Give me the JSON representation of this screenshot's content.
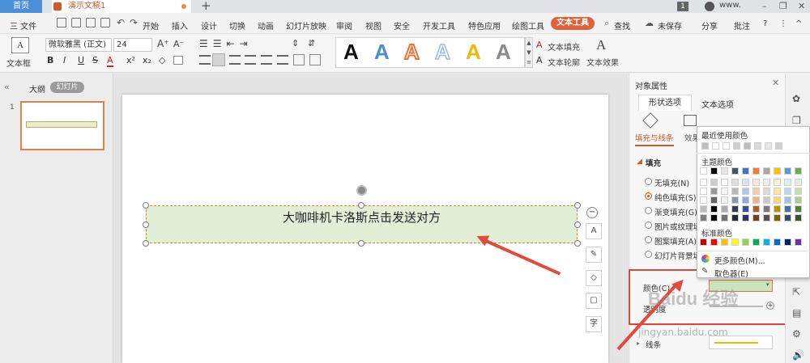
{
  "titlebar": {
    "home_tab": "首页",
    "doc_tab": "演示文稿1",
    "plus": "+",
    "page_num": "1",
    "user": "www.",
    "window_controls": [
      "–",
      "❐",
      "✕"
    ]
  },
  "menubar": {
    "file": "三 文件",
    "items": [
      "开始",
      "插入",
      "设计",
      "切换",
      "动画",
      "幻灯片放映",
      "审阅",
      "视图",
      "安全",
      "开发工具",
      "特色应用",
      "绘图工具"
    ],
    "active_tab": "文本工具",
    "search": "查找",
    "unsaved": "未保存",
    "share": "分享",
    "comment": "批注",
    "help": "?",
    "more": "⋮",
    "collapse": "^"
  },
  "ribbon": {
    "textbox_label": "文本框",
    "font_name": "微软雅黑 (正文)",
    "font_size": "24",
    "format_buttons": [
      "B",
      "I",
      "U",
      "S",
      "A",
      "x²",
      "x₂",
      "◇"
    ],
    "text_fill": "文本填充",
    "text_outline": "文本轮廓",
    "text_effect": "文本效果",
    "styles": [
      {
        "glyph": "A",
        "color": "#111111"
      },
      {
        "glyph": "A",
        "color": "#4a8fd0"
      },
      {
        "glyph": "A",
        "color": "#e8763a"
      },
      {
        "glyph": "A",
        "color": "#9eb8d8"
      },
      {
        "glyph": "A",
        "color": "#f2b705"
      },
      {
        "glyph": "A",
        "color": "#8a8a8a"
      }
    ]
  },
  "leftpane": {
    "outline_tab": "大纲",
    "slides_tab": "幻灯片",
    "slide_number": "1"
  },
  "slide": {
    "textbox_text": "大咖啡机卡洛斯点击发送对方"
  },
  "float_toolbar": [
    "A",
    "✎",
    "◇",
    "▢",
    "字"
  ],
  "panel": {
    "title": "对象属性",
    "tab_shape": "形状选项",
    "tab_text": "文本选项",
    "sub_fill_line": "填充与线条",
    "sub_effect": "效果",
    "fill_header": "填充",
    "fill_options": [
      {
        "label": "无填充(N)",
        "selected": false
      },
      {
        "label": "纯色填充(S)",
        "selected": true
      },
      {
        "label": "渐变填充(G)",
        "selected": false
      },
      {
        "label": "图片或纹理填充",
        "selected": false
      },
      {
        "label": "图案填充(A)",
        "selected": false
      },
      {
        "label": "幻灯片背景填充",
        "selected": false
      }
    ],
    "color_label": "颜色(C)",
    "transparency_label": "透明度",
    "line_label": "线条",
    "color_value": "#cbe4c0"
  },
  "color_popup": {
    "recent_title": "最近使用颜色",
    "theme_title": "主题颜色",
    "standard_title": "标准颜色",
    "more_colors": "更多颜色(M)...",
    "eyedropper": "取色器(E)",
    "recent": [
      "#bfbfbf",
      "#ffffff",
      "#ffffff",
      "#cfcfcf",
      "#bfbfbf",
      "#d9d9d9",
      "#e6e6e6",
      "#d0d0d0"
    ],
    "theme_base": [
      "#ffffff",
      "#000000",
      "#e7e6e6",
      "#44546a",
      "#4472c4",
      "#ed7d31",
      "#a5a5a5",
      "#ffc000",
      "#5b9bd5",
      "#70ad47"
    ],
    "standard": [
      "#c00000",
      "#ff0000",
      "#ffc000",
      "#ffff00",
      "#92d050",
      "#00b050",
      "#00b0f0",
      "#0070c0",
      "#002060",
      "#7030a0"
    ]
  },
  "watermark": "Baidu 经验",
  "watermark_url": "jingyan.baidu.com"
}
